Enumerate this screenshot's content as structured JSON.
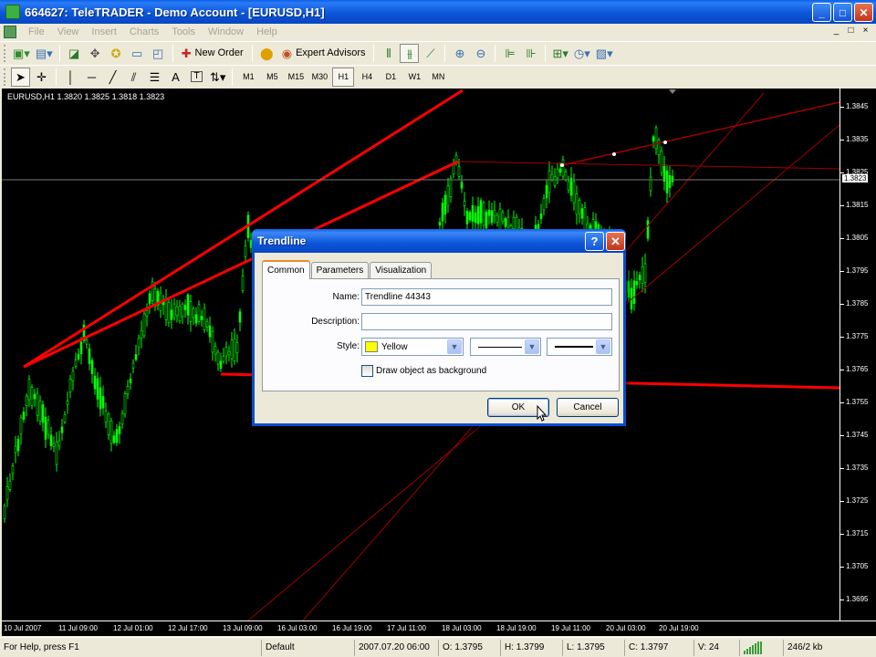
{
  "window": {
    "title": "664627: TeleTRADER - Demo Account - [EURUSD,H1]",
    "controls": {
      "minimize": "_",
      "maximize": "□",
      "close": "✕"
    }
  },
  "menu": {
    "items": [
      "File",
      "View",
      "Insert",
      "Charts",
      "Tools",
      "Window",
      "Help"
    ],
    "mdi_controls": [
      "_",
      "□",
      "×"
    ]
  },
  "toolbar1": {
    "new_order_label": "New Order",
    "expert_advisors_label": "Expert Advisors"
  },
  "toolbar2": {
    "timeframes": [
      "M1",
      "M5",
      "M15",
      "M30",
      "H1",
      "H4",
      "D1",
      "W1",
      "MN"
    ],
    "active_timeframe": "H1",
    "text_tool": "A",
    "label_tool": "T"
  },
  "chart": {
    "info": "EURUSD,H1  1.3820 1.3825 1.3818 1.3823",
    "current_price": "1.3823",
    "price_ticks": [
      "1.3845",
      "1.3835",
      "1.3825",
      "1.3815",
      "1.3805",
      "1.3795",
      "1.3785",
      "1.3775",
      "1.3765",
      "1.3755",
      "1.3745",
      "1.3735",
      "1.3725",
      "1.3715",
      "1.3705",
      "1.3695"
    ],
    "time_ticks": [
      "10 Jul 2007",
      "11 Jul 09:00",
      "12 Jul 01:00",
      "12 Jul 17:00",
      "13 Jul 09:00",
      "16 Jul 03:00",
      "16 Jul 19:00",
      "17 Jul 11:00",
      "18 Jul 03:00",
      "18 Jul 19:00",
      "19 Jul 11:00",
      "20 Jul 03:00",
      "20 Jul 19:00"
    ],
    "colors": {
      "background": "#000000",
      "candles": "#00ff00",
      "trendline": "#ff0000"
    }
  },
  "dialog": {
    "title": "Trendline",
    "help_button": "?",
    "close_button": "✕",
    "tabs": [
      "Common",
      "Parameters",
      "Visualization"
    ],
    "active_tab": "Common",
    "name_label": "Name:",
    "name_value": "Trendline 44343",
    "description_label": "Description:",
    "description_value": "",
    "style_label": "Style:",
    "color_value": "Yellow",
    "color_swatch": "#ffff00",
    "draw_background_label": "Draw object as background",
    "draw_background_checked": false,
    "ok_label": "OK",
    "cancel_label": "Cancel"
  },
  "statusbar": {
    "help_text": "For Help, press F1",
    "profile": "Default",
    "datetime": "2007.07.20 06:00",
    "open": "O: 1.3795",
    "high": "H: 1.3799",
    "low": "L: 1.3795",
    "close": "C: 1.3797",
    "volume": "V: 24",
    "traffic": "246/2 kb"
  }
}
